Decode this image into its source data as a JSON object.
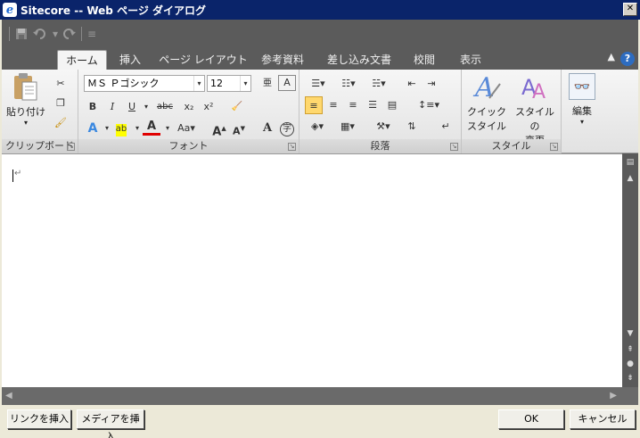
{
  "window": {
    "title": "Sitecore -- Web ページ ダイアログ",
    "close_glyph": "✕"
  },
  "quick_access": {
    "items": [
      "save-icon",
      "undo-icon",
      "redo-icon",
      "customize-icon"
    ]
  },
  "tabs": [
    {
      "label": "ホーム",
      "active": true
    },
    {
      "label": "挿入",
      "active": false
    },
    {
      "label": "ページ レイアウト",
      "active": false
    },
    {
      "label": "参考資料",
      "active": false
    },
    {
      "label": "差し込み文書",
      "active": false
    },
    {
      "label": "校閲",
      "active": false
    },
    {
      "label": "表示",
      "active": false
    }
  ],
  "ribbon": {
    "clipboard": {
      "paste_label": "貼り付け",
      "group_label": "クリップボード"
    },
    "font": {
      "font_name": "ＭＳ Ｐゴシック",
      "font_size": "12",
      "group_label": "フォント"
    },
    "paragraph": {
      "group_label": "段落"
    },
    "styles": {
      "quick_style_line1": "クイック",
      "quick_style_line2": "スタイル",
      "change_style_line1": "スタイルの",
      "change_style_line2": "変更",
      "group_label": "スタイル"
    },
    "editing": {
      "label": "編集"
    }
  },
  "footer": {
    "insert_link": "リンクを挿入",
    "insert_media": "メディアを挿入",
    "ok": "OK",
    "cancel": "キャンセル"
  },
  "colors": {
    "title_bg": "#0a246a",
    "ribbon_dark": "#5b5b5b",
    "accent_blue": "#2d6cc0"
  }
}
